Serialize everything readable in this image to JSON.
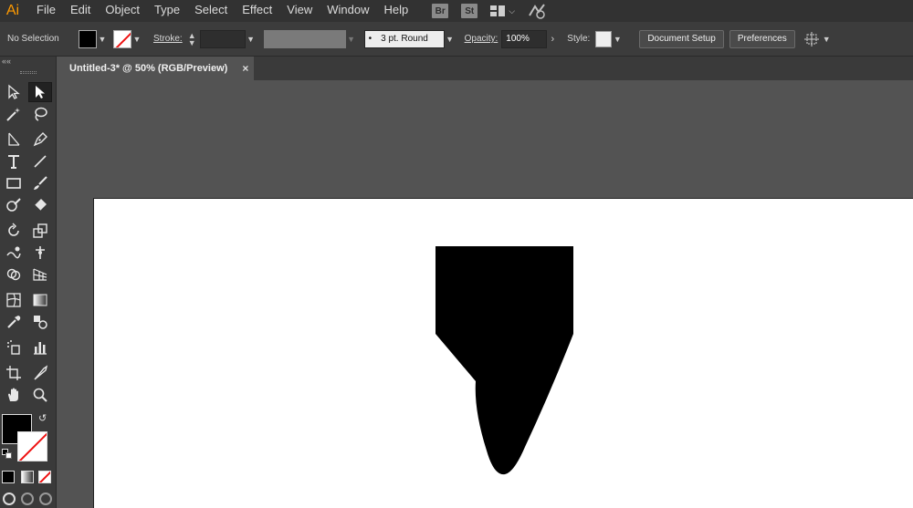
{
  "app": {
    "logo": "Ai"
  },
  "menu": {
    "items": [
      "File",
      "Edit",
      "Object",
      "Type",
      "Select",
      "Effect",
      "View",
      "Window",
      "Help"
    ],
    "bridge_badge": "Br",
    "stock_badge": "St"
  },
  "control": {
    "selection_label": "No Selection",
    "stroke_label": "Stroke:",
    "brush_value": "3 pt. Round",
    "opacity_label": "Opacity:",
    "opacity_value": "100%",
    "style_label": "Style:",
    "document_setup": "Document Setup",
    "preferences": "Preferences"
  },
  "tabs": [
    {
      "label": "Untitled-3* @ 50% (RGB/Preview)",
      "close": "×"
    }
  ],
  "tools": {
    "collapse": "««",
    "icons": [
      "selection-tool",
      "direct-selection-tool",
      "magic-wand-tool",
      "lasso-tool",
      "pen-tool",
      "curvature-tool",
      "type-tool",
      "line-tool",
      "rectangle-tool",
      "paintbrush-tool",
      "shaper-tool",
      "eraser-tool",
      "rotate-tool",
      "scale-tool",
      "warp-tool",
      "free-transform-tool",
      "shape-builder-tool",
      "perspective-grid-tool",
      "mesh-tool",
      "gradient-tool",
      "eyedropper-tool",
      "blend-tool",
      "symbol-sprayer-tool",
      "column-graph-tool",
      "artboard-tool",
      "slice-tool",
      "hand-tool",
      "zoom-tool"
    ]
  },
  "colors": {
    "fill": "#000000",
    "stroke": "none",
    "accent_logo": "#ff9a00"
  }
}
